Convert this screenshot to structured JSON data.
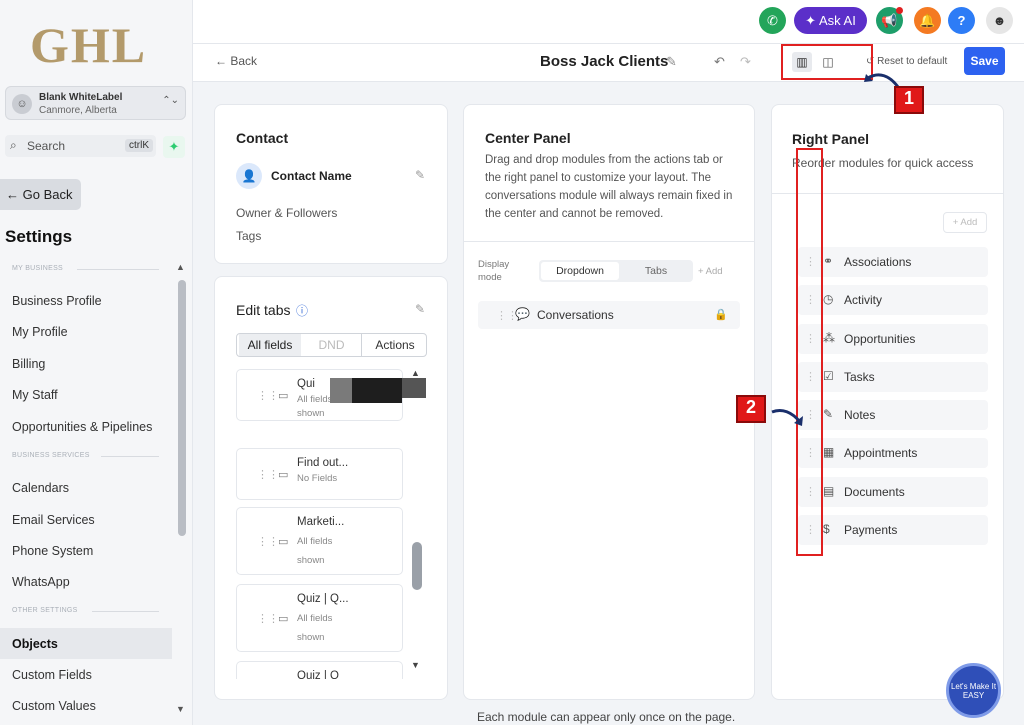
{
  "sidebar": {
    "logo": "GHL",
    "account_name": "Blank WhiteLabel",
    "account_location": "Canmore, Alberta",
    "search_label": "Search",
    "search_shortcut": "ctrlK",
    "go_back": "← Go Back",
    "settings_title": "Settings",
    "sections": [
      "MY BUSINESS",
      "BUSINESS SERVICES",
      "OTHER SETTINGS"
    ],
    "items": [
      "Business Profile",
      "My Profile",
      "Billing",
      "My Staff",
      "Opportunities & Pipelines",
      "Calendars",
      "Email Services",
      "Phone System",
      "WhatsApp",
      "Objects",
      "Custom Fields",
      "Custom Values"
    ]
  },
  "topbar": {
    "ask_ai": "Ask AI"
  },
  "header": {
    "back": "Back",
    "title": "Boss Jack Clients",
    "reset": "Reset to default",
    "save": "Save"
  },
  "contact": {
    "title": "Contact",
    "name": "Contact Name",
    "owner": "Owner & Followers",
    "tags": "Tags"
  },
  "edit_tabs": {
    "title": "Edit tabs",
    "tabs": [
      "All fields",
      "DND",
      "Actions"
    ],
    "cards": [
      {
        "title": "Qui",
        "sub1": "All fields",
        "sub2": "shown"
      },
      {
        "title": "Find out...",
        "sub1": "No Fields",
        "sub2": ""
      },
      {
        "title": "Marketi...",
        "sub1": "All fields",
        "sub2": "shown"
      },
      {
        "title": "Quiz | Q...",
        "sub1": "All fields",
        "sub2": "shown"
      },
      {
        "title": "Quiz | Q",
        "sub1": "",
        "sub2": ""
      }
    ]
  },
  "center": {
    "title": "Center Panel",
    "description": "Drag and drop modules from the actions tab or the right panel to customize your layout. The conversations module will always remain fixed in the center and cannot be removed.",
    "display_mode": "Display mode",
    "modes": [
      "Dropdown",
      "Tabs"
    ],
    "add": "+ Add",
    "conversations": "Conversations"
  },
  "right": {
    "title": "Right Panel",
    "description": "Reorder modules for quick access",
    "add": "+ Add",
    "modules": [
      "Associations",
      "Activity",
      "Opportunities",
      "Tasks",
      "Notes",
      "Appointments",
      "Documents",
      "Payments"
    ]
  },
  "annotations": {
    "badge1": "1",
    "badge2": "2"
  },
  "footer_note": "Each module can appear only once on the page.",
  "fab_text": "Let's Make It EASY",
  "colors": {
    "accent": "#2d62f0",
    "ask_ai": "#5b2fc9",
    "annotation_red": "#e02020",
    "logo": "#b39a6b"
  }
}
